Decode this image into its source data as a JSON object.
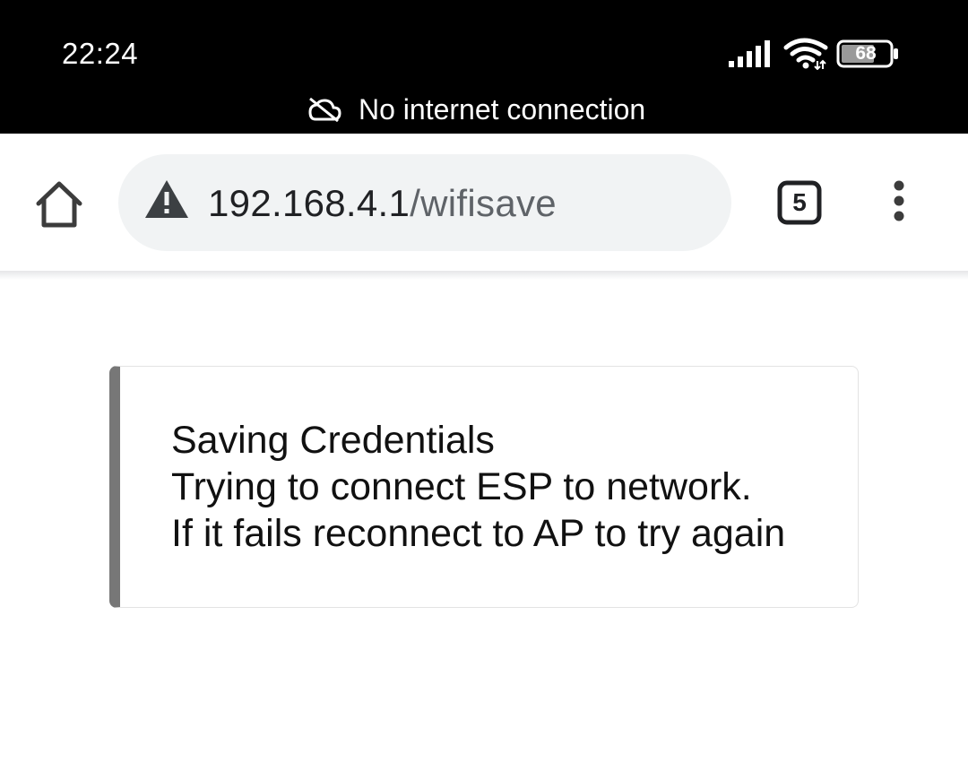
{
  "status_bar": {
    "time": "22:24",
    "battery_level": "68",
    "network_message": "No internet connection",
    "icons": [
      "signal-icon",
      "wifi-icon",
      "battery-icon",
      "cloud-off-icon"
    ]
  },
  "toolbar": {
    "url_host": "192.168.4.1",
    "url_path": "/wifisave",
    "tab_count": "5",
    "icons": [
      "home-icon",
      "warning-icon",
      "tab-switcher-icon",
      "overflow-menu-icon"
    ]
  },
  "page": {
    "message_lines": [
      "Saving Credentials",
      "Trying to connect ESP to network.",
      "If it fails reconnect to AP to try again"
    ]
  },
  "colors": {
    "status_bar_bg": "#000000",
    "omnibox_bg": "#f1f3f4",
    "card_accent": "#777777",
    "card_border": "#e3e3e3"
  }
}
